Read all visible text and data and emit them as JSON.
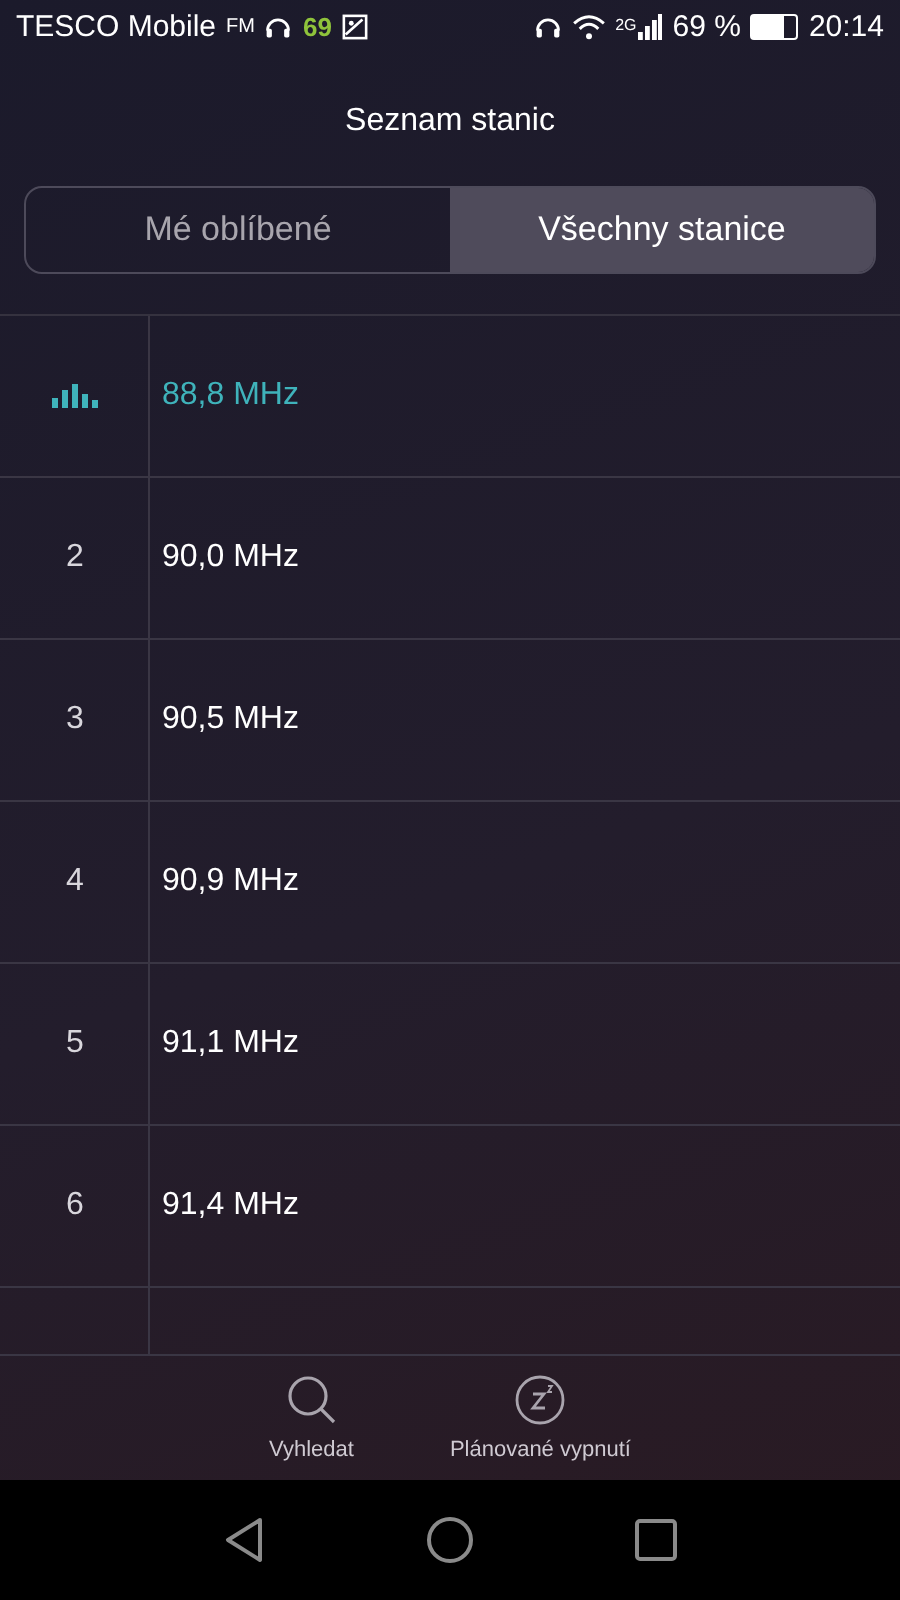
{
  "status_bar": {
    "carrier": "TESCO Mobile",
    "fm": "FM",
    "notification_count": "69",
    "network": "2G",
    "battery_text": "69 %",
    "time": "20:14"
  },
  "title": "Seznam stanic",
  "tabs": [
    {
      "label": "Mé oblíbené",
      "selected": false
    },
    {
      "label": "Všechny stanice",
      "selected": true
    }
  ],
  "stations": [
    {
      "frequency": "88,8 MHz",
      "playing": true
    },
    {
      "number": "2",
      "frequency": "90,0 MHz",
      "playing": false
    },
    {
      "number": "3",
      "frequency": "90,5 MHz",
      "playing": false
    },
    {
      "number": "4",
      "frequency": "90,9 MHz",
      "playing": false
    },
    {
      "number": "5",
      "frequency": "91,1 MHz",
      "playing": false
    },
    {
      "number": "6",
      "frequency": "91,4 MHz",
      "playing": false
    }
  ],
  "actions": [
    {
      "kind": "search",
      "label": "Vyhledat"
    },
    {
      "kind": "sleep",
      "label": "Plánované vypnutí"
    }
  ]
}
